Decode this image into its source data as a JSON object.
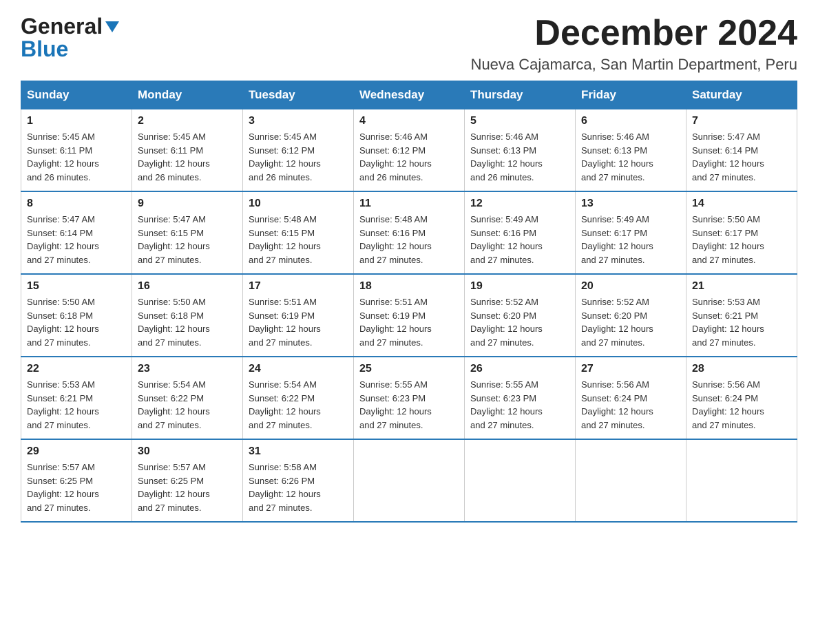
{
  "header": {
    "logo_general": "General",
    "logo_blue": "Blue",
    "month_title": "December 2024",
    "location": "Nueva Cajamarca, San Martin Department, Peru"
  },
  "days_of_week": [
    "Sunday",
    "Monday",
    "Tuesday",
    "Wednesday",
    "Thursday",
    "Friday",
    "Saturday"
  ],
  "weeks": [
    [
      {
        "day": "1",
        "sunrise": "5:45 AM",
        "sunset": "6:11 PM",
        "daylight": "12 hours and 26 minutes."
      },
      {
        "day": "2",
        "sunrise": "5:45 AM",
        "sunset": "6:11 PM",
        "daylight": "12 hours and 26 minutes."
      },
      {
        "day": "3",
        "sunrise": "5:45 AM",
        "sunset": "6:12 PM",
        "daylight": "12 hours and 26 minutes."
      },
      {
        "day": "4",
        "sunrise": "5:46 AM",
        "sunset": "6:12 PM",
        "daylight": "12 hours and 26 minutes."
      },
      {
        "day": "5",
        "sunrise": "5:46 AM",
        "sunset": "6:13 PM",
        "daylight": "12 hours and 26 minutes."
      },
      {
        "day": "6",
        "sunrise": "5:46 AM",
        "sunset": "6:13 PM",
        "daylight": "12 hours and 27 minutes."
      },
      {
        "day": "7",
        "sunrise": "5:47 AM",
        "sunset": "6:14 PM",
        "daylight": "12 hours and 27 minutes."
      }
    ],
    [
      {
        "day": "8",
        "sunrise": "5:47 AM",
        "sunset": "6:14 PM",
        "daylight": "12 hours and 27 minutes."
      },
      {
        "day": "9",
        "sunrise": "5:47 AM",
        "sunset": "6:15 PM",
        "daylight": "12 hours and 27 minutes."
      },
      {
        "day": "10",
        "sunrise": "5:48 AM",
        "sunset": "6:15 PM",
        "daylight": "12 hours and 27 minutes."
      },
      {
        "day": "11",
        "sunrise": "5:48 AM",
        "sunset": "6:16 PM",
        "daylight": "12 hours and 27 minutes."
      },
      {
        "day": "12",
        "sunrise": "5:49 AM",
        "sunset": "6:16 PM",
        "daylight": "12 hours and 27 minutes."
      },
      {
        "day": "13",
        "sunrise": "5:49 AM",
        "sunset": "6:17 PM",
        "daylight": "12 hours and 27 minutes."
      },
      {
        "day": "14",
        "sunrise": "5:50 AM",
        "sunset": "6:17 PM",
        "daylight": "12 hours and 27 minutes."
      }
    ],
    [
      {
        "day": "15",
        "sunrise": "5:50 AM",
        "sunset": "6:18 PM",
        "daylight": "12 hours and 27 minutes."
      },
      {
        "day": "16",
        "sunrise": "5:50 AM",
        "sunset": "6:18 PM",
        "daylight": "12 hours and 27 minutes."
      },
      {
        "day": "17",
        "sunrise": "5:51 AM",
        "sunset": "6:19 PM",
        "daylight": "12 hours and 27 minutes."
      },
      {
        "day": "18",
        "sunrise": "5:51 AM",
        "sunset": "6:19 PM",
        "daylight": "12 hours and 27 minutes."
      },
      {
        "day": "19",
        "sunrise": "5:52 AM",
        "sunset": "6:20 PM",
        "daylight": "12 hours and 27 minutes."
      },
      {
        "day": "20",
        "sunrise": "5:52 AM",
        "sunset": "6:20 PM",
        "daylight": "12 hours and 27 minutes."
      },
      {
        "day": "21",
        "sunrise": "5:53 AM",
        "sunset": "6:21 PM",
        "daylight": "12 hours and 27 minutes."
      }
    ],
    [
      {
        "day": "22",
        "sunrise": "5:53 AM",
        "sunset": "6:21 PM",
        "daylight": "12 hours and 27 minutes."
      },
      {
        "day": "23",
        "sunrise": "5:54 AM",
        "sunset": "6:22 PM",
        "daylight": "12 hours and 27 minutes."
      },
      {
        "day": "24",
        "sunrise": "5:54 AM",
        "sunset": "6:22 PM",
        "daylight": "12 hours and 27 minutes."
      },
      {
        "day": "25",
        "sunrise": "5:55 AM",
        "sunset": "6:23 PM",
        "daylight": "12 hours and 27 minutes."
      },
      {
        "day": "26",
        "sunrise": "5:55 AM",
        "sunset": "6:23 PM",
        "daylight": "12 hours and 27 minutes."
      },
      {
        "day": "27",
        "sunrise": "5:56 AM",
        "sunset": "6:24 PM",
        "daylight": "12 hours and 27 minutes."
      },
      {
        "day": "28",
        "sunrise": "5:56 AM",
        "sunset": "6:24 PM",
        "daylight": "12 hours and 27 minutes."
      }
    ],
    [
      {
        "day": "29",
        "sunrise": "5:57 AM",
        "sunset": "6:25 PM",
        "daylight": "12 hours and 27 minutes."
      },
      {
        "day": "30",
        "sunrise": "5:57 AM",
        "sunset": "6:25 PM",
        "daylight": "12 hours and 27 minutes."
      },
      {
        "day": "31",
        "sunrise": "5:58 AM",
        "sunset": "6:26 PM",
        "daylight": "12 hours and 27 minutes."
      },
      null,
      null,
      null,
      null
    ]
  ],
  "labels": {
    "sunrise": "Sunrise:",
    "sunset": "Sunset:",
    "daylight": "Daylight:"
  }
}
